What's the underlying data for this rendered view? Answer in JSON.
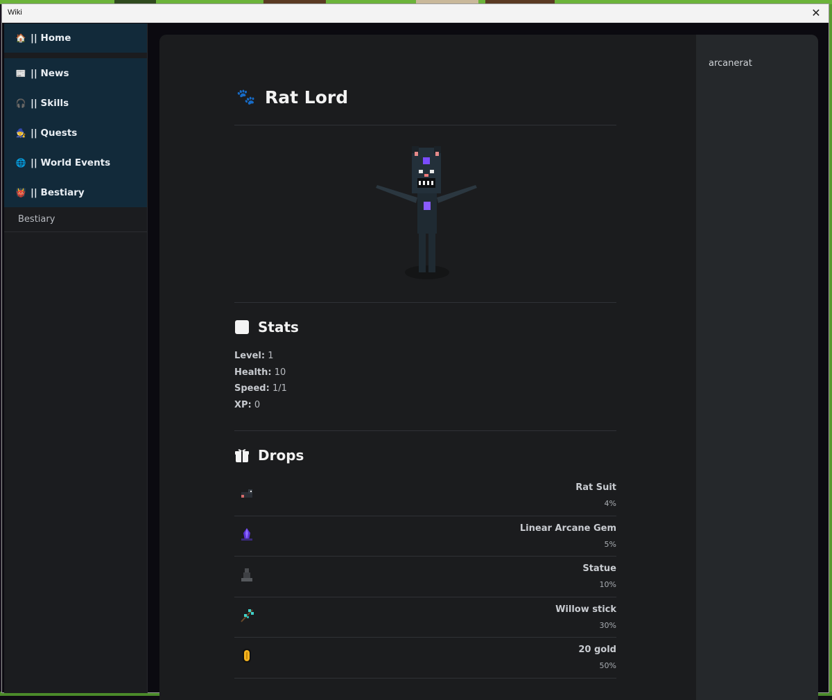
{
  "window": {
    "title": "Wiki",
    "close_glyph": "✕"
  },
  "sidebar": {
    "items": [
      {
        "label": "|| Home",
        "icon": "house-icon",
        "glyph": "🏠"
      },
      {
        "label": "|| News",
        "icon": "newspaper-icon",
        "glyph": "📰"
      },
      {
        "label": "|| Skills",
        "icon": "headphones-icon",
        "glyph": "🎧"
      },
      {
        "label": "|| Quests",
        "icon": "scroll-person-icon",
        "glyph": "🧙"
      },
      {
        "label": "|| World Events",
        "icon": "globe-icon",
        "glyph": "🌐"
      },
      {
        "label": "|| Bestiary",
        "icon": "demon-icon",
        "glyph": "👹"
      }
    ],
    "sub_item": "Bestiary"
  },
  "right_rail": {
    "text": "arcanerat"
  },
  "page": {
    "title": "Rat Lord",
    "title_glyph": "🐾"
  },
  "stats": {
    "heading": "Stats",
    "items": [
      {
        "key": "Level:",
        "value": "1"
      },
      {
        "key": "Health:",
        "value": "10"
      },
      {
        "key": "Speed:",
        "value": "1/1"
      },
      {
        "key": "XP:",
        "value": "0"
      }
    ]
  },
  "drops": {
    "heading": "Drops",
    "items": [
      {
        "name": "Rat Suit",
        "chance": "4%",
        "icon": "rat-suit-icon"
      },
      {
        "name": "Linear Arcane Gem",
        "chance": "5%",
        "icon": "arcane-gem-icon"
      },
      {
        "name": "Statue",
        "chance": "10%",
        "icon": "statue-icon"
      },
      {
        "name": "Willow stick",
        "chance": "30%",
        "icon": "willow-stick-icon"
      },
      {
        "name": "20 gold",
        "chance": "50%",
        "icon": "gold-coin-icon"
      }
    ]
  },
  "colors": {
    "sidebar_active": "#122a3a",
    "panel": "#1b1c1e",
    "rail": "#25282b",
    "accent_purple": "#7a4cff",
    "gold": "#f4b21d"
  }
}
